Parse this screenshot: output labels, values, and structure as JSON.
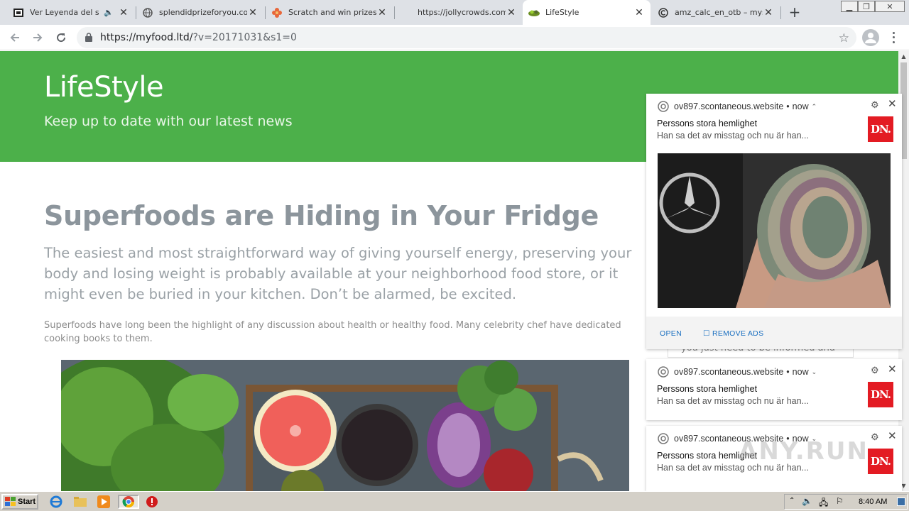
{
  "browser": {
    "tabs": [
      {
        "title": "Ver Leyenda del sub",
        "favicon": "video-icon",
        "audio": true,
        "active": false
      },
      {
        "title": "splendidprizeforyou.com",
        "favicon": "globe-icon",
        "active": false
      },
      {
        "title": "Scratch and win prizes e",
        "favicon": "flower-icon",
        "active": false
      },
      {
        "title": "https://jollycrowds.com/",
        "favicon": "blank-icon",
        "active": false
      },
      {
        "title": "LifeStyle",
        "favicon": "food-icon",
        "active": true
      },
      {
        "title": "amz_calc_en_otb – mysi",
        "favicon": "c-icon",
        "active": false
      }
    ],
    "new_tab": "+",
    "url": {
      "host": "https://myfood.ltd/",
      "path": "?v=20171031&s1=0"
    }
  },
  "page": {
    "site_title": "LifeStyle",
    "tagline": "Keep up to date with our latest news",
    "headline": "Superfoods are Hiding in Your Fridge",
    "lead": "The easiest and most straightforward way of giving yourself energy, preserving your body and losing weight is probably available at your neighborhood food store, or it might even be buried in your kitchen. Don’t be alarmed, be excited.",
    "body": "Superfoods have long been the highlight of any discussion about health or healthy food. Many celebrity chef have dedicated cooking books to them.",
    "peek_text": "you just need to be informed and"
  },
  "notifications": [
    {
      "site": "ov897.scontaneous.website",
      "time": "now",
      "chevron": "⌃",
      "title": "Perssons stora hemlighet",
      "body": "Han sa det av misstag och nu är han...",
      "logo": "DN.",
      "actions": {
        "open": "OPEN",
        "remove": "REMOVE ADS"
      }
    },
    {
      "site": "ov897.scontaneous.website",
      "time": "now",
      "chevron": "⌄",
      "title": "Perssons stora hemlighet",
      "body": "Han sa det av misstag och nu är han...",
      "logo": "DN."
    },
    {
      "site": "ov897.scontaneous.website",
      "time": "now",
      "chevron": "⌄",
      "title": "Perssons stora hemlighet",
      "body": "Han sa det av misstag och nu är han...",
      "logo": "DN."
    }
  ],
  "watermark": "ANY.RUN",
  "taskbar": {
    "start": "Start",
    "clock": "8:40 AM"
  },
  "colors": {
    "hero_green": "#4cb04a",
    "dn_red": "#e31b23",
    "link_blue": "#1a6fc0"
  }
}
